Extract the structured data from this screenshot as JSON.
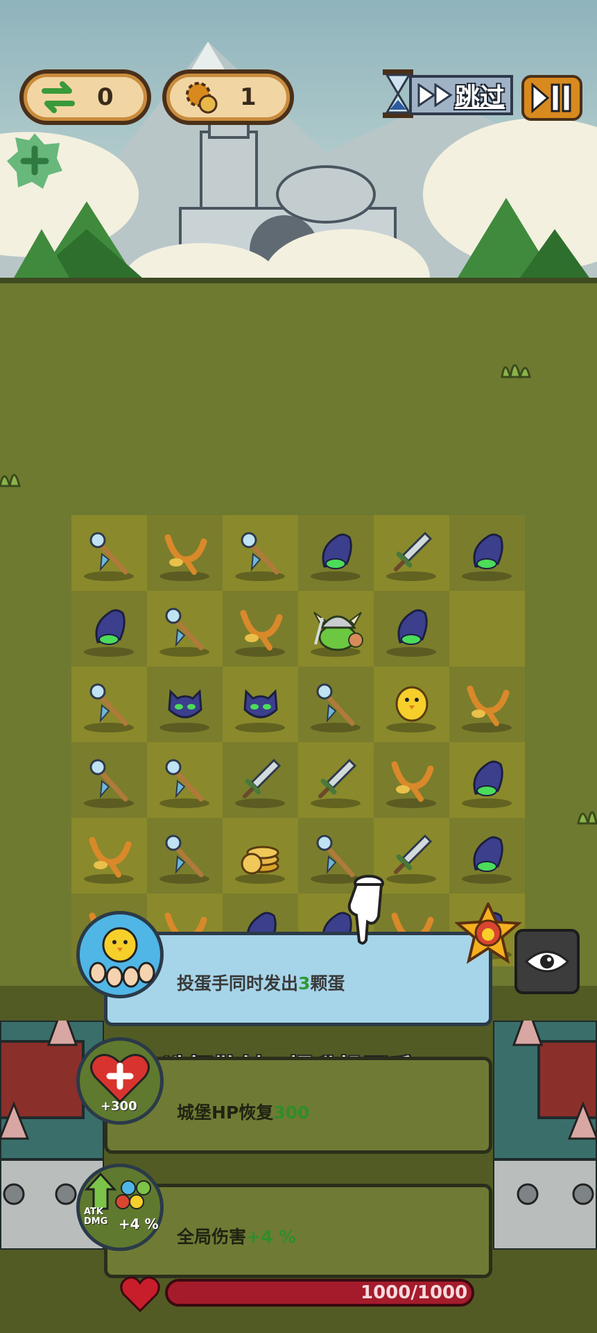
{
  "hud": {
    "swap_count": "0",
    "reroll_count": "1",
    "skip_label": "跳过",
    "icons": {
      "swap": "swap-arrows-icon",
      "reroll": "gear-moon-icon",
      "timer": "hourglass-icon",
      "skip": "fast-forward-icon",
      "pause": "play-pause-icon",
      "add": "green-plus-badge-icon"
    }
  },
  "board": {
    "rows": [
      [
        "staff",
        "slingshot",
        "staff",
        "cursed-hand",
        "sword",
        "cursed-hand"
      ],
      [
        "cursed-hand",
        "staff",
        "slingshot",
        "viking-slime",
        "cursed-hand",
        "empty"
      ],
      [
        "staff",
        "dark-cat",
        "dark-cat",
        "staff",
        "chick",
        "slingshot"
      ],
      [
        "staff",
        "staff",
        "sword",
        "sword",
        "slingshot",
        "cursed-hand"
      ],
      [
        "slingshot",
        "staff",
        "coin-stack",
        "staff",
        "sword",
        "cursed-hand"
      ],
      [
        "slingshot",
        "slingshot",
        "cursed-hand",
        "cursed-hand",
        "slingshot",
        "cursed-hand"
      ]
    ]
  },
  "tutorial": {
    "hint": "选择散射，提升投蛋手",
    "pointer": "pointing-hand-icon"
  },
  "options": [
    {
      "text_prefix": "投蛋手同时发出",
      "highlight": "3",
      "text_suffix": "颗蛋",
      "icon": "chick-eggs-icon",
      "badge": "star-badge-icon",
      "selected": true
    },
    {
      "text_prefix": "城堡HP恢复",
      "highlight": "300",
      "text_suffix": "",
      "icon": "heart-plus-icon",
      "icon_label": "+300"
    },
    {
      "text_prefix": "全局伤害",
      "highlight": "+4 %",
      "text_suffix": "",
      "icon": "atk-dmg-icon",
      "icon_label": "+4 %",
      "icon_caption": "ATK DMG"
    }
  ],
  "castle": {
    "hp": "1000/1000",
    "hp_fraction": 1.0,
    "icons": {
      "heart": "heart-icon",
      "view": "eye-icon"
    }
  },
  "colors": {
    "accent": "#2f9a33",
    "hp": "#8b1524",
    "card_selected": "#a6d5ea"
  }
}
